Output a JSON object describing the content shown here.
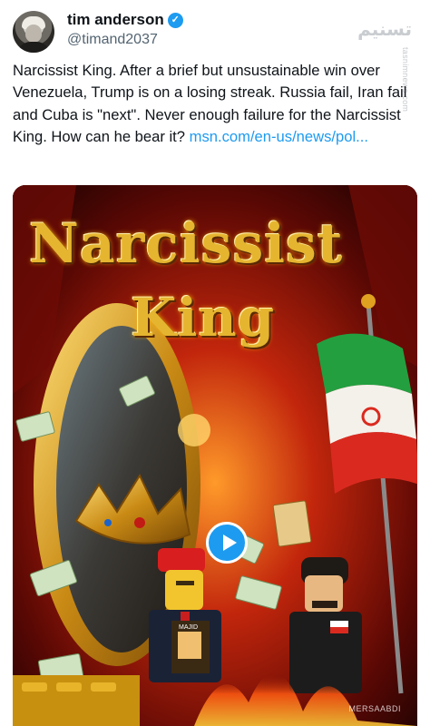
{
  "user": {
    "display_name": "tim anderson",
    "handle": "@timand2037",
    "verified_icon": "verified-badge-icon",
    "avatar_icon": "avatar-photo"
  },
  "watermark": {
    "text": "تسنیم",
    "vertical": "tasnimnews.com"
  },
  "tweet": {
    "text": "Narcissist King. After a brief but unsustainable win over Venezuela, Trump is on a losing streak. Russia fail, Iran fail and Cuba is \"next\". Never enough failure for the Narcissist King. How can he bear it? ",
    "link": "msn.com/en-us/news/pol..."
  },
  "media": {
    "title_line1": "Narcissist",
    "title_line2": "King",
    "sign_text": "MAJID",
    "credit": "MERSAABDI",
    "play_icon": "play-icon",
    "colors": {
      "accent": "#1d9bf0",
      "title_gold": "#e6b530",
      "background_red": "#7a0b05"
    }
  }
}
